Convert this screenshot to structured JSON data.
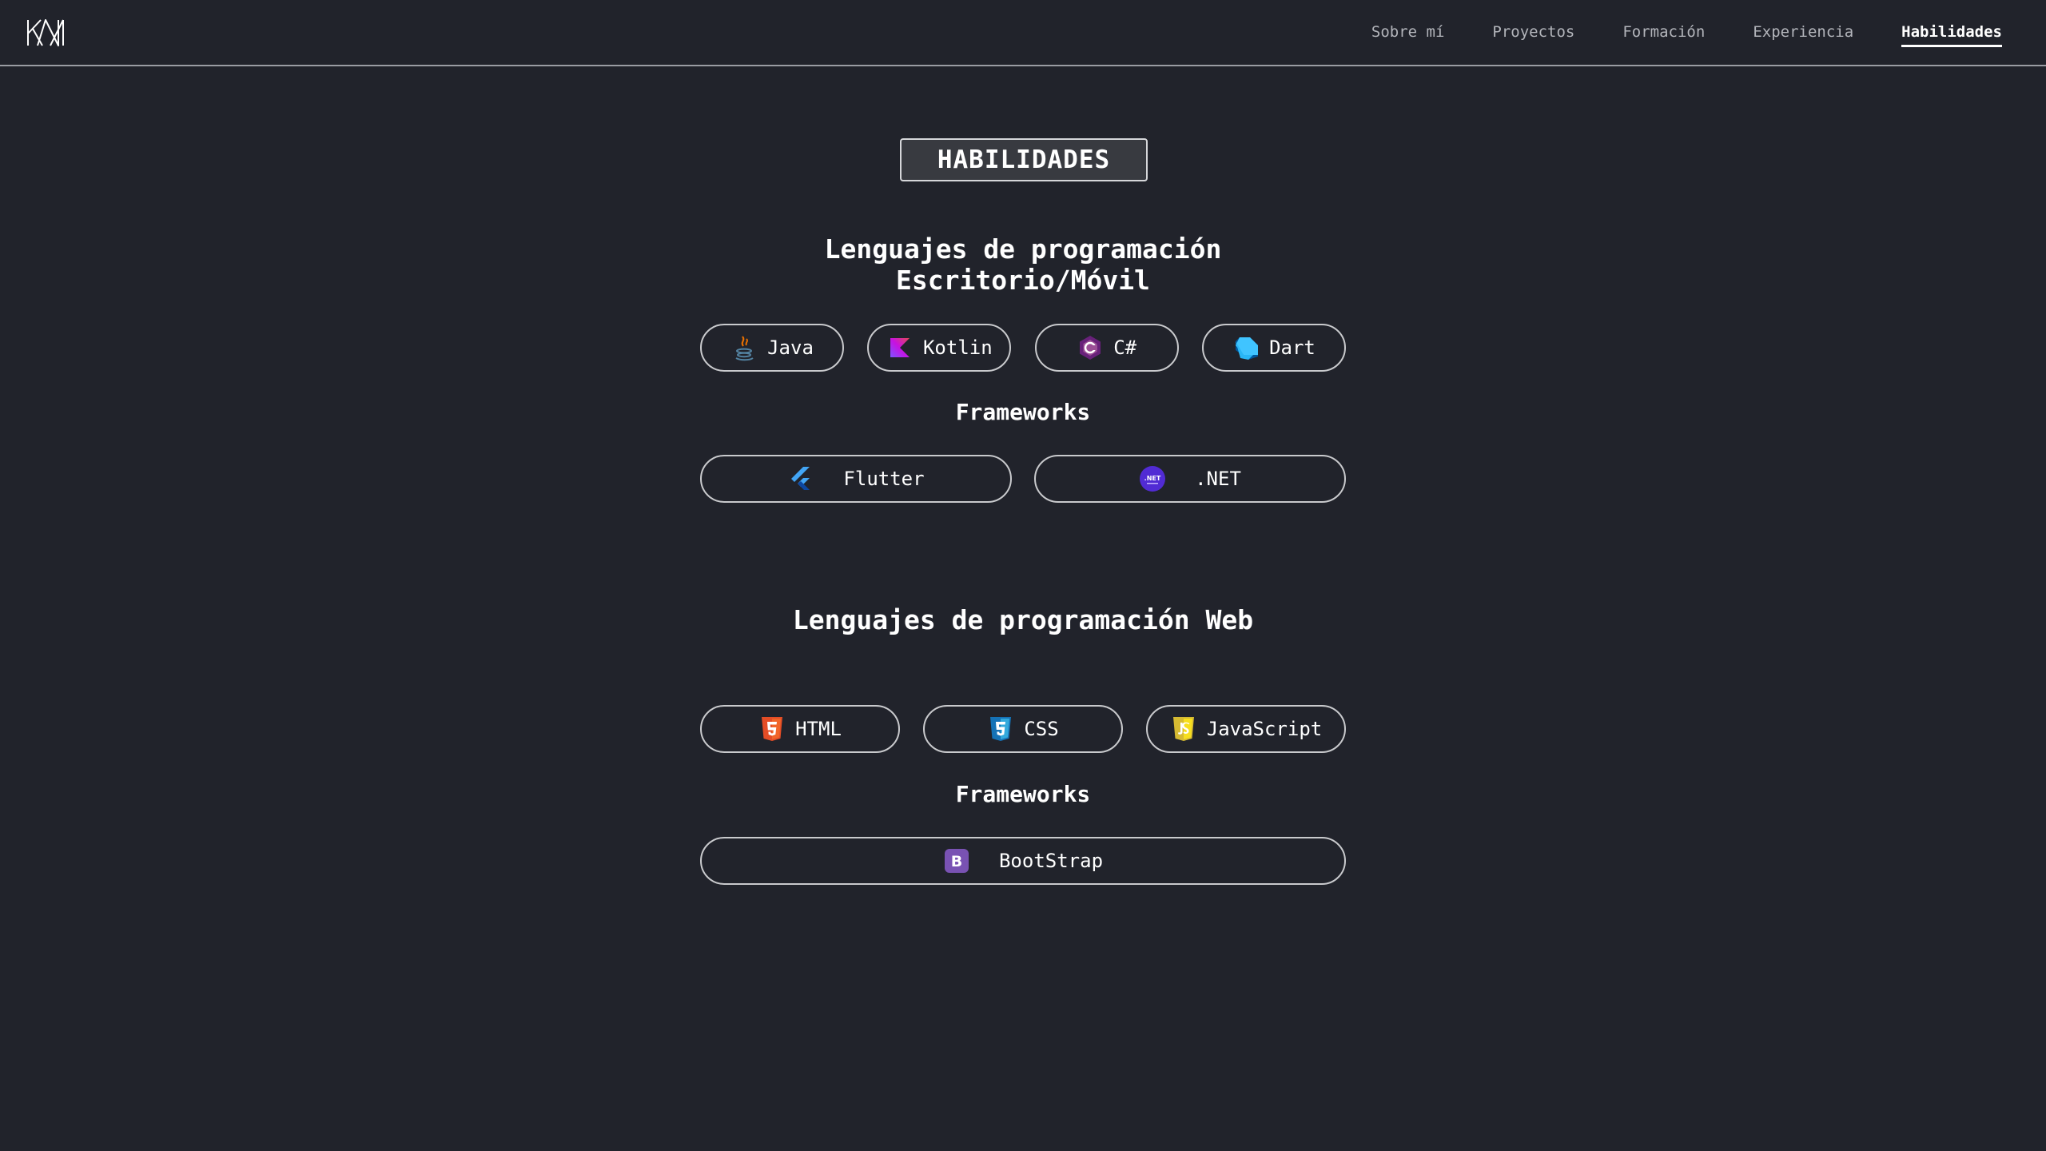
{
  "nav": {
    "logo_text": "KN",
    "links": [
      "Sobre mí",
      "Proyectos",
      "Formación",
      "Experiencia",
      "Habilidades"
    ],
    "active": "Habilidades"
  },
  "page": {
    "badge": "HABILIDADES"
  },
  "desktop": {
    "title": "Lenguajes de programación Escritorio/Móvil",
    "languages": [
      {
        "label": "Java",
        "icon": "java-icon"
      },
      {
        "label": "Kotlin",
        "icon": "kotlin-icon"
      },
      {
        "label": "C#",
        "icon": "csharp-icon"
      },
      {
        "label": "Dart",
        "icon": "dart-icon"
      }
    ],
    "frameworks_title": "Frameworks",
    "frameworks": [
      {
        "label": "Flutter",
        "icon": "flutter-icon"
      },
      {
        "label": ".NET",
        "icon": "dotnet-icon"
      }
    ]
  },
  "web": {
    "title": "Lenguajes de programación Web",
    "languages": [
      {
        "label": "HTML",
        "icon": "html5-icon"
      },
      {
        "label": "CSS",
        "icon": "css3-icon"
      },
      {
        "label": "JavaScript",
        "icon": "javascript-icon"
      }
    ],
    "frameworks_title": "Frameworks",
    "frameworks": [
      {
        "label": "BootStrap",
        "icon": "bootstrap-icon"
      }
    ]
  },
  "colors": {
    "background": "#21232b",
    "border": "#c9cacd",
    "text": "#ffffff",
    "nav_inactive": "#b3b5bb"
  }
}
